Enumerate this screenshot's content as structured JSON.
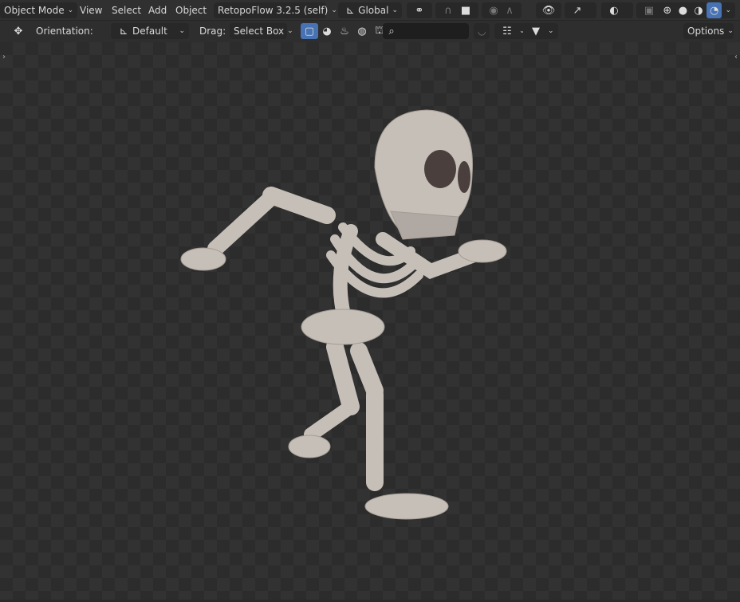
{
  "header": {
    "mode": "Object Mode",
    "menus": [
      "View",
      "Select",
      "Add",
      "Object"
    ],
    "addon": "RetopoFlow 3.2.5 (self)",
    "orientation": "Global"
  },
  "toolbar": {
    "orientation_label": "Orientation:",
    "orientation_value": "Default",
    "drag_label": "Drag:",
    "drag_value": "Select Box",
    "search_placeholder": "",
    "options": "Options"
  },
  "viewport": {
    "object": "skeleton model"
  },
  "colors": {
    "accent": "#4772b3",
    "bone": "#c9c2bb"
  }
}
